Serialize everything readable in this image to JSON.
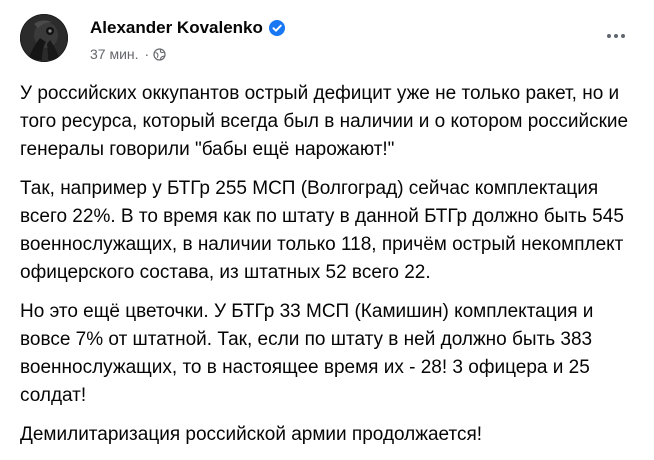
{
  "post": {
    "author": "Alexander Kovalenko",
    "time": "37 мин.",
    "separator": "·",
    "icons": {
      "verified": "verified-badge-icon",
      "audience": "globe-icon",
      "more": "more-options-icon"
    },
    "colors": {
      "verified": "#1877f2",
      "meta_text": "#65676b",
      "body_text": "#050505"
    },
    "paragraphs": [
      "У российских оккупантов острый дефицит уже не только ракет, но и того ресурса, который всегда был в наличии и о котором российские генералы говорили \"бабы ещё нарожают!\"",
      "Так, например у БТГр 255 МСП (Волгоград) сейчас комплектация всего 22%. В то время как по штату в данной БТГр должно быть 545 военнослужащих, в наличии только 118, причём острый некомплект офицерского состава, из штатных 52 всего 22.",
      "Но это ещё цветочки. У БТГр 33 МСП (Камишин) комплектация и вовсе 7% от штатной. Так, если по штату в ней должно быть 383 военнослужащих, то в настоящее время их - 28! 3 офицера и 25 солдат!",
      "Демилитаризация российской армии продолжается!"
    ]
  }
}
